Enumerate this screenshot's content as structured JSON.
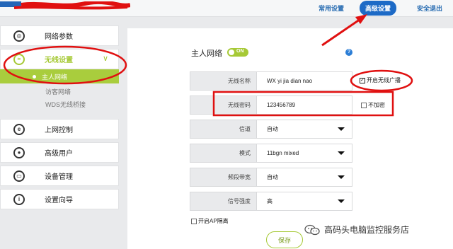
{
  "top_nav": {
    "items": [
      {
        "label": "常用设置"
      },
      {
        "label": "高级设置",
        "active": true
      },
      {
        "label": "安全退出"
      }
    ]
  },
  "sidebar": {
    "items": [
      {
        "label": "网络参数",
        "icon": "globe-icon"
      },
      {
        "label": "无线设置",
        "icon": "wifi-icon",
        "active": true
      },
      {
        "label": "上网控制",
        "icon": "control-icon"
      },
      {
        "label": "高级用户",
        "icon": "user-icon"
      },
      {
        "label": "设备管理",
        "icon": "device-icon"
      },
      {
        "label": "设置向导",
        "icon": "info-icon"
      }
    ],
    "subitems": [
      {
        "label": "主人网络",
        "active": true
      },
      {
        "label": "访客网络"
      },
      {
        "label": "WDS无线桥接"
      }
    ]
  },
  "main": {
    "title": "主人网络",
    "toggle": "ON",
    "help": "?",
    "fields": [
      {
        "label": "无线名称",
        "value": "WX yi jia dian nao"
      },
      {
        "label": "无线密码",
        "value": "123456789"
      },
      {
        "label": "信道",
        "value": "自动"
      },
      {
        "label": "模式",
        "value": "11bgn mixed"
      },
      {
        "label": "频段带宽",
        "value": "自动"
      },
      {
        "label": "信号强度",
        "value": "高"
      }
    ],
    "broadcast_checkbox": "开启无线广播",
    "no_encrypt_checkbox": "不加密",
    "ap_isolation_checkbox": "开启AP隔离",
    "save_label": "保存"
  },
  "watermark": "高码头电脑监控服务店",
  "colors": {
    "accent": "#a6c936",
    "nav_active": "#1d6ac6",
    "annotation": "#e01010"
  }
}
